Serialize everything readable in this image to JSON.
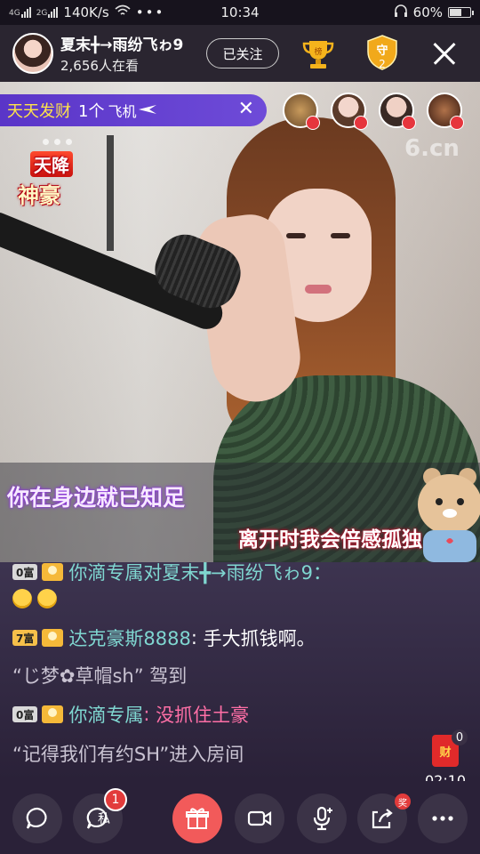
{
  "status_bar": {
    "network": "4G",
    "network_secondary": "2G",
    "speed": "140K/s",
    "time": "10:34",
    "battery": "60%",
    "battery_level": 0.6
  },
  "header": {
    "host_name": "夏末╋→雨纷飞ゎ9",
    "viewer_count": "2,656人在看",
    "follow_label": "已关注",
    "trophy_label": "榜",
    "guard_label": "守",
    "guard_count": "2"
  },
  "video": {
    "gift_banner": {
      "sender": "天天发财",
      "amount": "1个",
      "gift": "飞机"
    },
    "event_badge": {
      "line1": "天降",
      "line2": "神豪"
    },
    "watermark": "6.cn",
    "lyric_1": "你在身边就已知足",
    "lyric_2": "离开时我会倍感孤独"
  },
  "chat": {
    "rows": [
      {
        "level": "0富",
        "name": "你滴专属对夏末╋→雨纷飞ゎ9：",
        "cut": true
      },
      {
        "level": "7富",
        "name": "达克豪斯8888",
        "message": "手大抓钱啊。"
      },
      {
        "system": "“じ梦✿草帽sh” 驾到"
      },
      {
        "level": "0富",
        "name": "你滴专属",
        "message": "没抓住土豪"
      },
      {
        "system": "“记得我们有约SH”进入房间"
      }
    ],
    "emoji_count": 2,
    "red_packet_label": "财",
    "red_packet_count": "0",
    "timer": "02:10"
  },
  "bottom_bar": {
    "private_label": "私",
    "private_unread": "1",
    "share_badge": "奖"
  },
  "colors": {
    "accent_gift": "#f25a5a",
    "banner": "#6e4bd8",
    "teal_name": "#7fd6d0",
    "pink_message": "#ff6fa6"
  }
}
